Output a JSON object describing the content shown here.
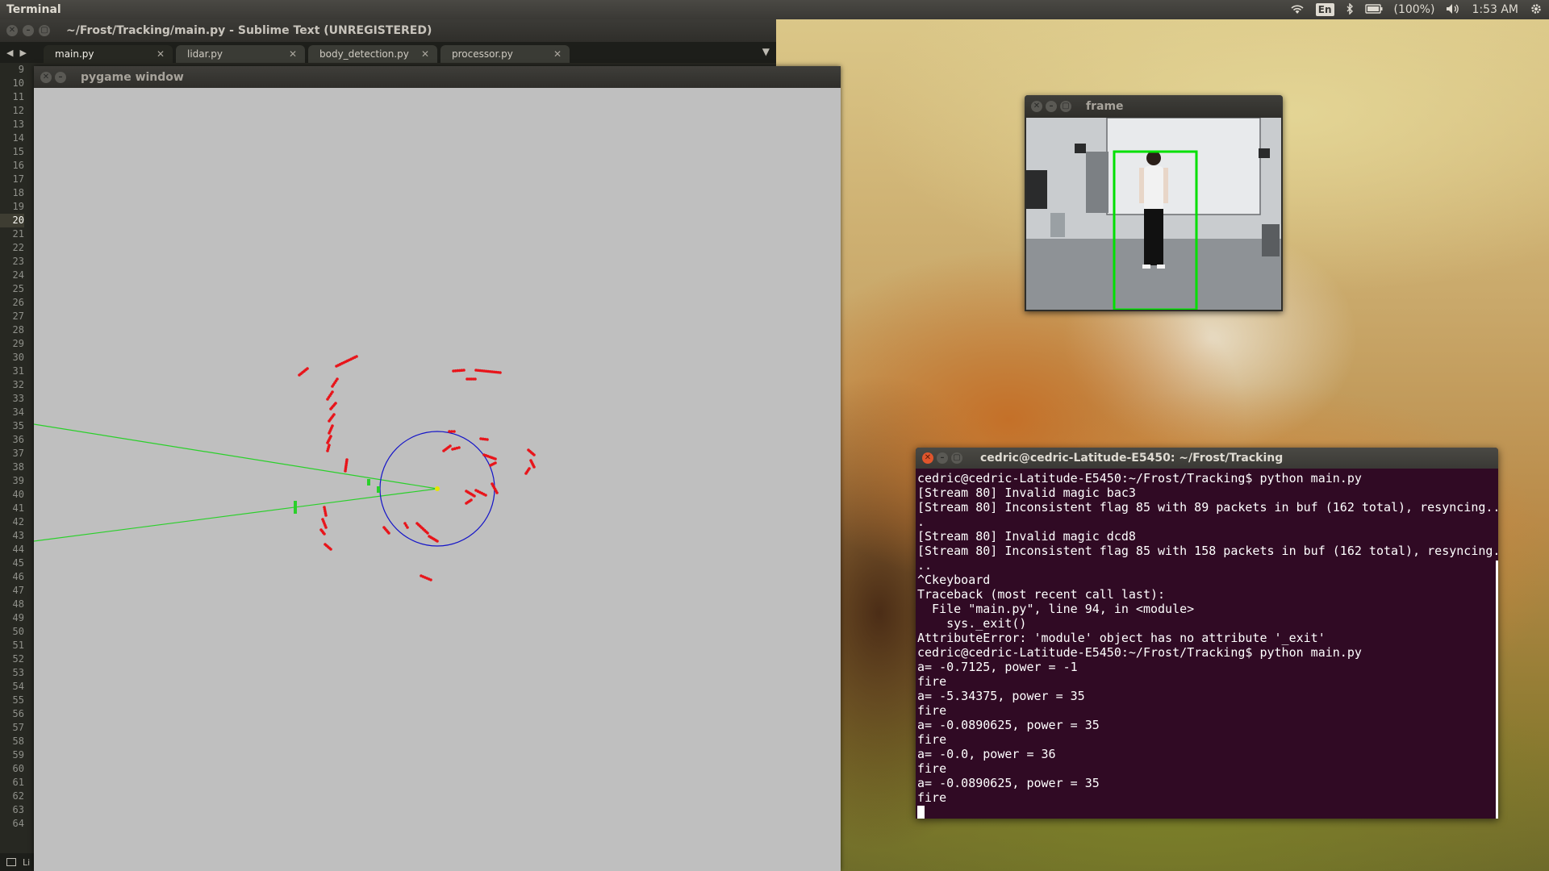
{
  "top_panel": {
    "app_name": "Terminal",
    "keyboard_layout": "En",
    "battery": "(100%)",
    "clock": "1:53 AM"
  },
  "sublime": {
    "title": "~/Frost/Tracking/main.py - Sublime Text (UNREGISTERED)",
    "tabs": [
      {
        "label": "main.py",
        "active": true
      },
      {
        "label": "lidar.py",
        "active": false
      },
      {
        "label": "body_detection.py",
        "active": false
      },
      {
        "label": "processor.py",
        "active": false
      }
    ],
    "line_numbers": [
      9,
      10,
      11,
      12,
      13,
      14,
      15,
      16,
      17,
      18,
      19,
      20,
      21,
      22,
      23,
      24,
      25,
      26,
      27,
      28,
      29,
      30,
      31,
      32,
      33,
      34,
      35,
      36,
      37,
      38,
      39,
      40,
      41,
      42,
      43,
      44,
      45,
      46,
      47,
      48,
      49,
      50,
      51,
      52,
      53,
      54,
      55,
      56,
      57,
      58,
      59,
      60,
      61,
      62,
      63,
      64
    ],
    "current_line": 20,
    "status_text": "Li"
  },
  "pygame": {
    "title": "pygame window",
    "background": "#bfbfbf",
    "point_color": "#e8141a",
    "target_color": "#2ad02a",
    "circle_color": "#1414c8",
    "center_color": "#e6e600"
  },
  "frame": {
    "title": "frame",
    "box_color": "#00e000"
  },
  "terminal": {
    "title": "cedric@cedric-Latitude-E5450: ~/Frost/Tracking",
    "lines": [
      "cedric@cedric-Latitude-E5450:~/Frost/Tracking$ python main.py",
      "[Stream 80] Invalid magic bac3",
      "[Stream 80] Inconsistent flag 85 with 89 packets in buf (162 total), resyncing..",
      ".",
      "[Stream 80] Invalid magic dcd8",
      "[Stream 80] Inconsistent flag 85 with 158 packets in buf (162 total), resyncing.",
      "..",
      "^Ckeyboard",
      "Traceback (most recent call last):",
      "  File \"main.py\", line 94, in <module>",
      "    sys._exit()",
      "AttributeError: 'module' object has no attribute '_exit'",
      "cedric@cedric-Latitude-E5450:~/Frost/Tracking$ python main.py",
      "a= -0.7125, power = -1",
      "fire",
      "a= -5.34375, power = 35",
      "fire",
      "a= -0.0890625, power = 35",
      "fire",
      "a= -0.0, power = 36",
      "fire",
      "a= -0.0890625, power = 35",
      "fire"
    ]
  }
}
